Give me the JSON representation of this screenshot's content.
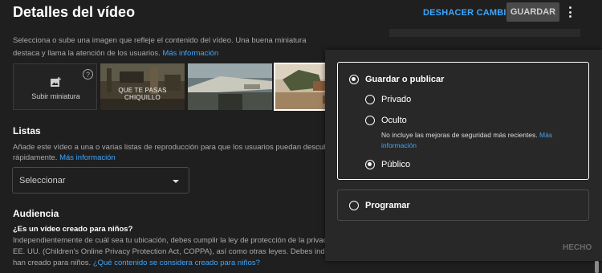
{
  "header": {
    "title": "Detalles del vídeo",
    "undo_label": "DESHACER CAMBIOS",
    "save_label": "GUARDAR"
  },
  "thumbnail": {
    "description": "Selecciona o sube una imagen que refleje el contenido del vídeo. Una buena miniatura destaca y llama la atención de los usuarios.",
    "link": "Más información",
    "upload_label": "Subir miniatura",
    "help_icon": "help-icon",
    "upload_icon": "add-photo-icon",
    "options": [
      {
        "caption": "QUE TE PASAS CHIQUILLO",
        "selected": false
      },
      {
        "caption": "",
        "selected": false
      },
      {
        "caption": "",
        "selected": true
      }
    ]
  },
  "playlists": {
    "title": "Listas",
    "description_line1": "Añade este vídeo a una o varias listas de reproducción para que los usuarios puedan descubrir tu co",
    "description_line2": "rápidamente.",
    "link": "Más información",
    "select_placeholder": "Seleccionar"
  },
  "audience": {
    "title": "Audiencia",
    "question": "¿Es un vídeo creado para niños?",
    "line1": "Independientemente de cuál sea tu ubicación, debes cumplir la ley de protección de la privacidad inf",
    "line2": "EE. UU. (Children's Online Privacy Protection Act, COPPA), así como otras leyes. Debes indicarnos si",
    "line3": "han creado para niños.",
    "link": "¿Qué contenido se considera creado para niños?"
  },
  "visibility": {
    "save_publish": {
      "label": "Guardar o publicar",
      "checked": true
    },
    "private": {
      "label": "Privado",
      "checked": false
    },
    "hidden": {
      "label": "Oculto",
      "checked": false,
      "note": "No incluye las mejoras de seguridad más recientes.",
      "note_link_1": "Más",
      "note_link_2": "información"
    },
    "public": {
      "label": "Público",
      "checked": true
    },
    "schedule": {
      "label": "Programar",
      "checked": false
    },
    "done_label": "HECHO"
  }
}
